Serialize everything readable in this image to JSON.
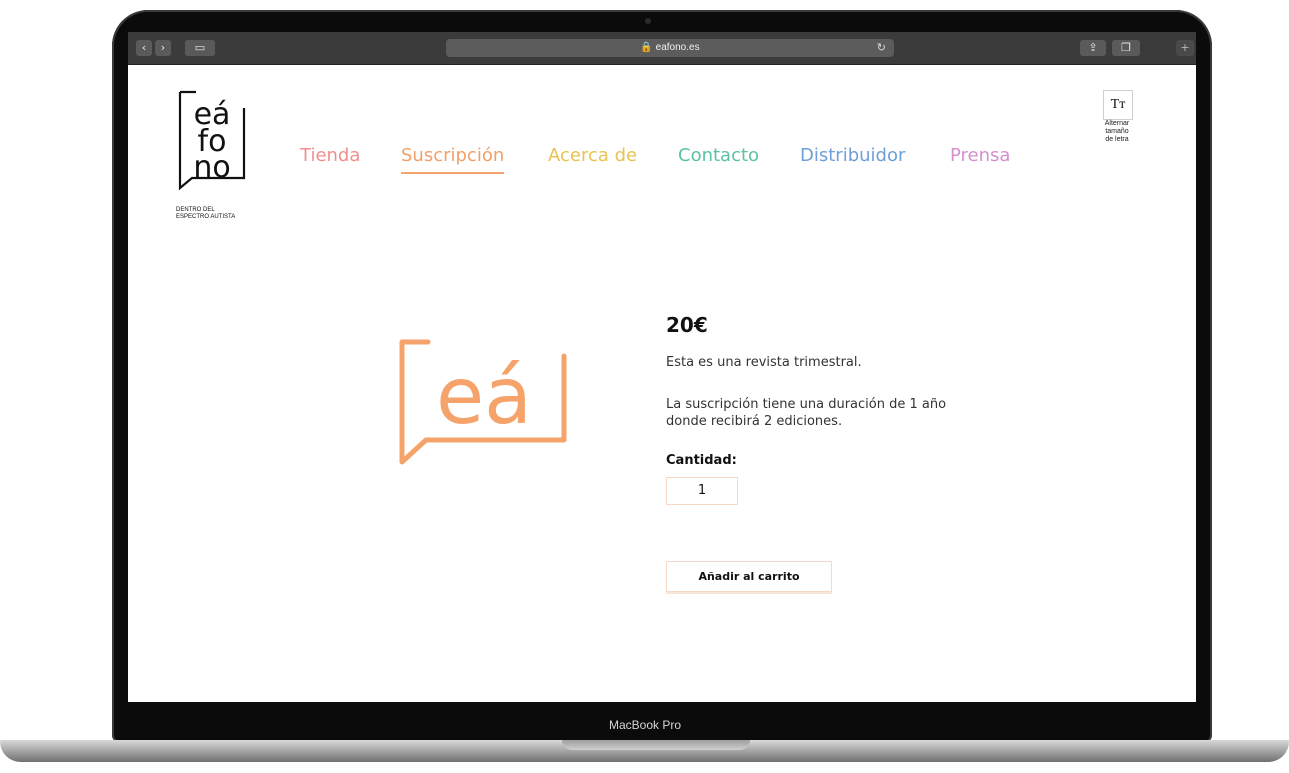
{
  "device": {
    "brand_label": "MacBook Pro"
  },
  "browser": {
    "url": "eafono.es",
    "lock_icon": "lock-icon",
    "back_icon": "chevron-left-icon",
    "forward_icon": "chevron-right-icon",
    "sidebar_icon": "sidebar-icon",
    "reload_icon": "reload-icon",
    "share_icon": "share-icon",
    "tabs_icon": "tabs-icon",
    "new_tab_icon": "plus-icon"
  },
  "site": {
    "logo": {
      "letters": [
        "eá",
        "fo",
        "no"
      ],
      "tagline_line1": "DENTRO DEL",
      "tagline_line2": "ESPECTRO AUTISTA"
    },
    "nav": [
      {
        "label": "Tienda",
        "color": "#f08f8f"
      },
      {
        "label": "Suscripción",
        "color": "#f2a06a",
        "active": true
      },
      {
        "label": "Acerca de",
        "color": "#e8c255"
      },
      {
        "label": "Contacto",
        "color": "#5cc2a4"
      },
      {
        "label": "Distribuidor",
        "color": "#6f9fd6"
      },
      {
        "label": "Prensa",
        "color": "#d58fd0"
      }
    ],
    "font_toggle": {
      "glyph": "Tт",
      "label_line1": "Alternar",
      "label_line2": "tamaño",
      "label_line3": "de letra"
    }
  },
  "product": {
    "logo_text": "eá",
    "logo_color": "#f5a36a",
    "price": "20€",
    "description_1": "Esta es una revista trimestral.",
    "description_2": "La suscripción tiene una duración de 1 año donde recibirá 2 ediciones.",
    "quantity_label": "Cantidad:",
    "quantity_value": "1",
    "add_to_cart_label": "Añadir al carrito"
  }
}
